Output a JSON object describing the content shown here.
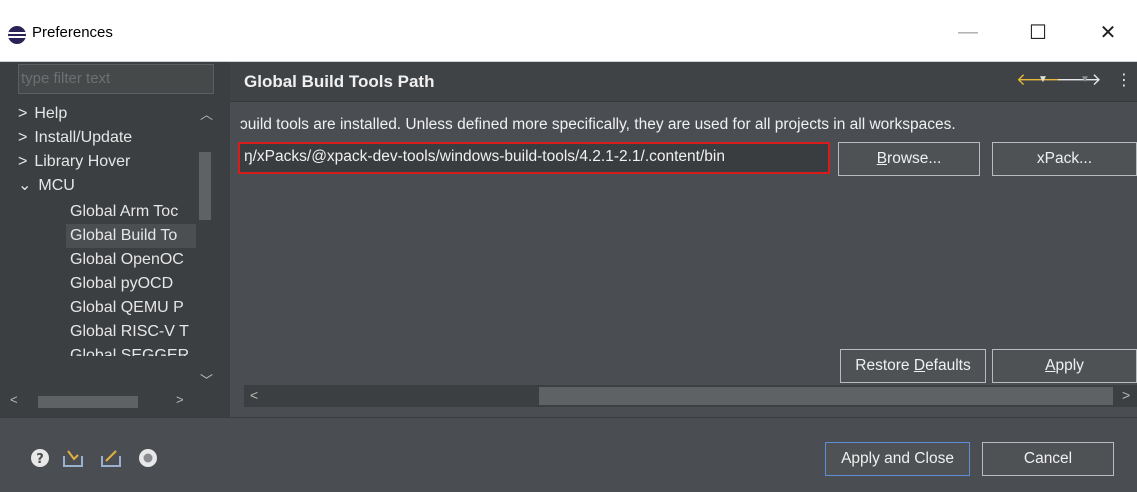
{
  "window": {
    "title": "Preferences",
    "minimize_label": "—",
    "maximize_label": "☐",
    "close_label": "✕"
  },
  "sidebar": {
    "filter_placeholder": "type filter text",
    "items": [
      {
        "label": "Help",
        "expander": ">"
      },
      {
        "label": "Install/Update",
        "expander": ">"
      },
      {
        "label": "Library Hover",
        "expander": ">"
      },
      {
        "label": "MCU",
        "expander": "⌄"
      },
      {
        "label": "Global Arm Toc"
      },
      {
        "label": "Global Build To"
      },
      {
        "label": "Global OpenOC"
      },
      {
        "label": "Global pyOCD"
      },
      {
        "label": "Global QEMU P"
      },
      {
        "label": "Global RISC-V T"
      },
      {
        "label": "Global SEGGER"
      }
    ],
    "selected_item": "Global Build To"
  },
  "main": {
    "page_title": "Global Build Tools Path",
    "description": "build tools are installed. Unless defined more specifically, they are used for all projects in all workspaces.",
    "description_visible": "ɔuild tools are installed. Unless defined more specifically, they are used for all projects in all workspaces.",
    "path_value": "ŋ/xPacks/@xpack-dev-tools/windows-build-tools/4.2.1-2.1/.content/bin",
    "browse_label_underline": "B",
    "browse_label_rest": "rowse...",
    "xpack_label": "xPack...",
    "restore_label_pre": "Restore ",
    "restore_label_underline": "D",
    "restore_label_post": "efaults",
    "apply_label_underline": "A",
    "apply_label_rest": "pply"
  },
  "footer": {
    "apply_close_label": "Apply and Close",
    "cancel_label": "Cancel",
    "icons": [
      "help-icon",
      "import-icon",
      "export-icon",
      "record-icon"
    ]
  },
  "colors": {
    "accent_highlight": "#d81c1c",
    "primary_button_border": "#5e8fd6",
    "nav_arrow": "#e8b83a"
  }
}
